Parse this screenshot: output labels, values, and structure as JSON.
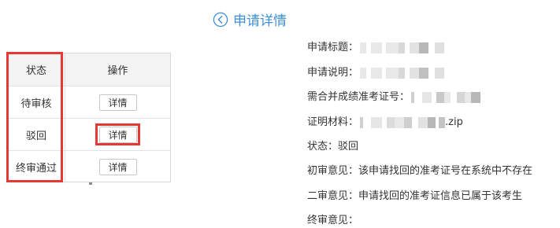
{
  "table": {
    "headers": {
      "status": "状态",
      "action": "操作"
    },
    "rows": [
      {
        "status": "待审核",
        "action": "详情"
      },
      {
        "status": "驳回",
        "action": "详情"
      },
      {
        "status": "终审通过",
        "action": "详情"
      }
    ]
  },
  "detail": {
    "back_icon": "chevron-left-circle-icon",
    "title": "申请详情",
    "fields": {
      "apply_title_label": "申请标题：",
      "apply_desc_label": "申请说明：",
      "ticket_label": "需合并成绩准考证号：",
      "proof_label": "证明材料：",
      "proof_ext": ".zip",
      "status_label": "状态：",
      "status_value": "驳回",
      "first_review_label": "初审意见：",
      "first_review_value": "该申请找回的准考证号在系统中不存在",
      "second_review_label": "二审意见：",
      "second_review_value": "申请找回的准考证信息已属于该考生",
      "final_review_label": "终审意见：",
      "final_review_value": ""
    }
  },
  "colors": {
    "highlight": "#e53935",
    "accent": "#3d8fd8",
    "mask_light": "#e8e8e8",
    "mask_dark": "#b8b8b8"
  }
}
